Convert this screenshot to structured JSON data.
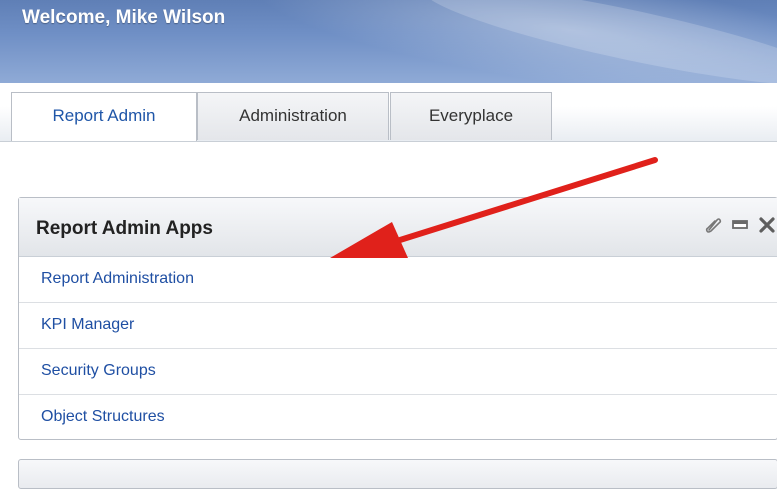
{
  "banner": {
    "welcome": "Welcome, Mike Wilson"
  },
  "tabs": [
    {
      "label": "Report Admin",
      "active": true
    },
    {
      "label": "Administration",
      "active": false
    },
    {
      "label": "Everyplace",
      "active": false
    }
  ],
  "portlet": {
    "title": "Report Admin Apps",
    "icons": [
      "edit-icon",
      "minimize-icon",
      "close-icon"
    ],
    "links": [
      {
        "label": "Report Administration"
      },
      {
        "label": "KPI Manager"
      },
      {
        "label": "Security Groups"
      },
      {
        "label": "Object Structures"
      }
    ]
  },
  "colors": {
    "link": "#1f4fa3",
    "active_tab_text": "#1f56a8",
    "annotation_arrow": "#e0211b"
  }
}
